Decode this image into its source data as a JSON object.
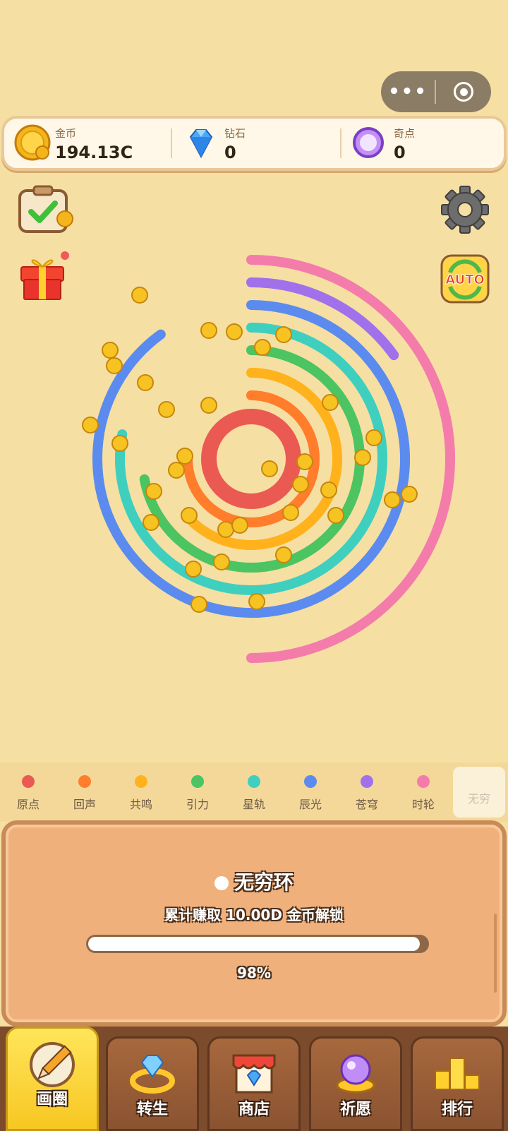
{
  "capsule": {
    "more_label": "•••"
  },
  "currencies": [
    {
      "label": "金币",
      "value": "194.13C",
      "icon": "gold-coin-icon"
    },
    {
      "label": "钻石",
      "value": "0",
      "icon": "diamond-icon"
    },
    {
      "label": "奇点",
      "value": "0",
      "icon": "purple-orb-icon"
    }
  ],
  "side_buttons": {
    "tasks": "clipboard-check-icon",
    "gift": "gift-icon",
    "settings": "gear-icon",
    "auto": "AUTO"
  },
  "rings": [
    {
      "name": "原点",
      "color": "#ea5a52"
    },
    {
      "name": "回声",
      "color": "#ff7d2b"
    },
    {
      "name": "共鸣",
      "color": "#ffb21c"
    },
    {
      "name": "引力",
      "color": "#4cc461"
    },
    {
      "name": "星轨",
      "color": "#3fcfbf"
    },
    {
      "name": "辰光",
      "color": "#5b8bef"
    },
    {
      "name": "苍穹",
      "color": "#a071ea"
    },
    {
      "name": "时轮",
      "color": "#f47cab"
    },
    {
      "name": "无穷",
      "color": "#ffffff"
    }
  ],
  "ring_fill": [
    1.0,
    0.75,
    0.62,
    0.72,
    0.78,
    0.9,
    0.15,
    0.5
  ],
  "panel": {
    "title": "无穷环",
    "subtitle": "累计赚取 10.00D 金币解锁",
    "progress": 0.98,
    "progress_label": "98%"
  },
  "nav": [
    {
      "label": "画圈",
      "icon": "pencil-icon",
      "active": true
    },
    {
      "label": "转生",
      "icon": "diamond-ring-icon",
      "active": false
    },
    {
      "label": "商店",
      "icon": "shop-icon",
      "active": false
    },
    {
      "label": "祈愿",
      "icon": "crystal-ball-icon",
      "active": false
    },
    {
      "label": "排行",
      "icon": "podium-icon",
      "active": false
    }
  ]
}
